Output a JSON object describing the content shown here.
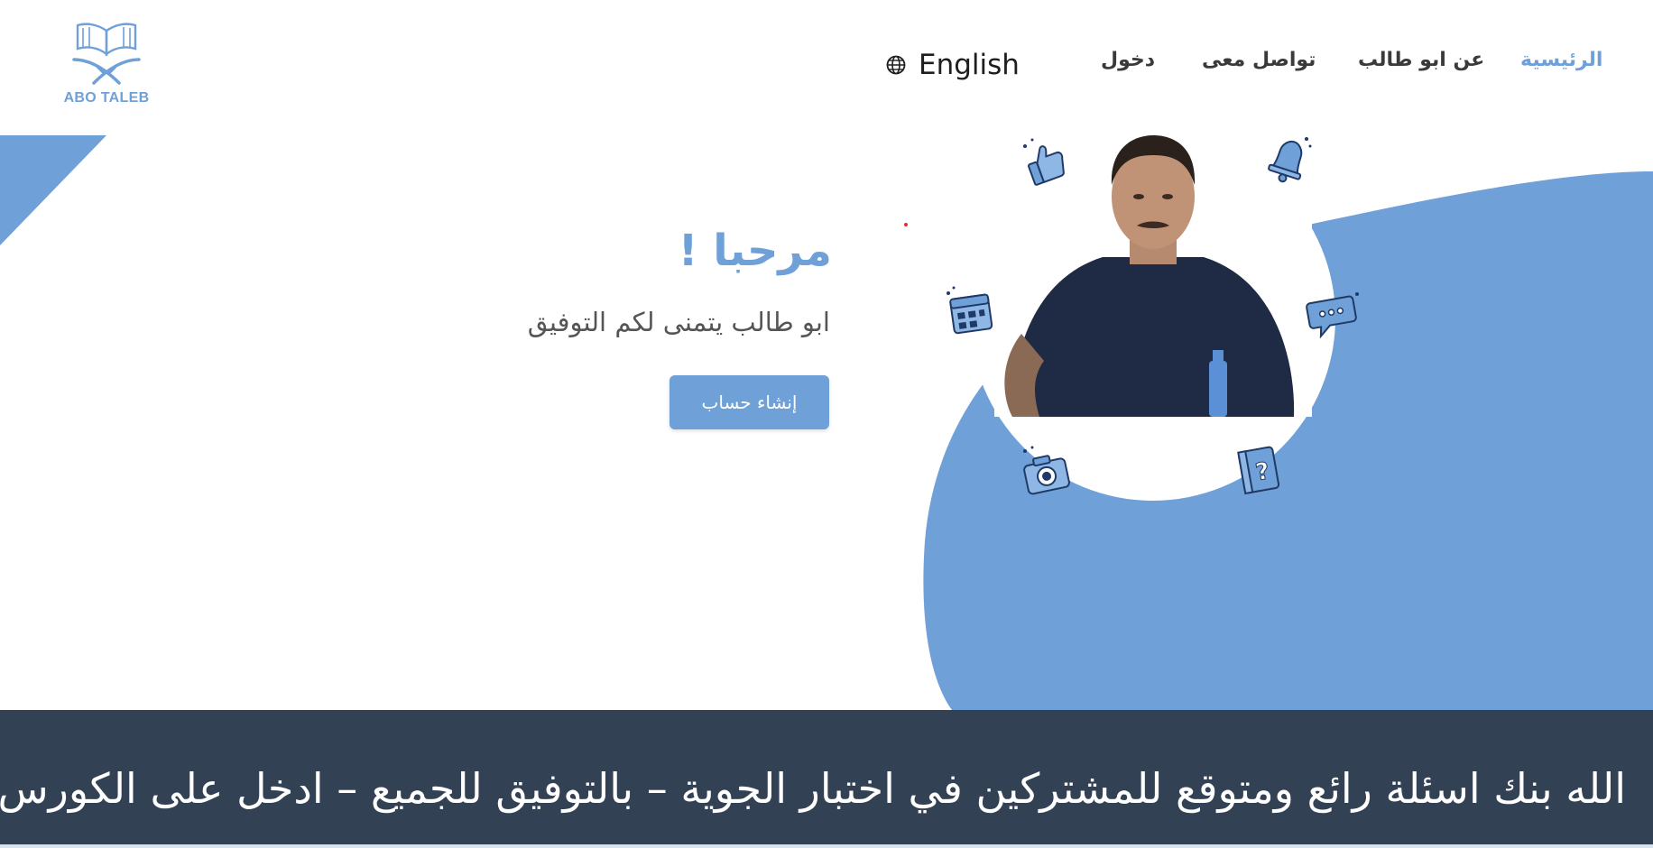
{
  "brand": {
    "logo_text": "ABO TALEB",
    "color": "#6fa0d8"
  },
  "nav": {
    "home": "الرئيسية",
    "about": "عن ابو طالب",
    "contact": "تواصل معى",
    "login": "دخول",
    "language": "English",
    "active_color": "#6fa0d8"
  },
  "hero": {
    "title": "مرحبا !",
    "subtitle": "ابو طالب يتمنى لكم التوفيق",
    "cta_label": "إنشاء حساب"
  },
  "icons": {
    "photo": "profile-photo",
    "floating": [
      "thumbs-up-icon",
      "bell-icon",
      "calendar-icon",
      "chat-icon",
      "camera-icon",
      "question-book-icon"
    ]
  },
  "banner": {
    "text": "الله بنك اسئلة رائع ومتوقع للمشتركين في اختبار الجوية – بالتوفيق للجميع – ادخل على الكورس",
    "background": "#334155"
  }
}
